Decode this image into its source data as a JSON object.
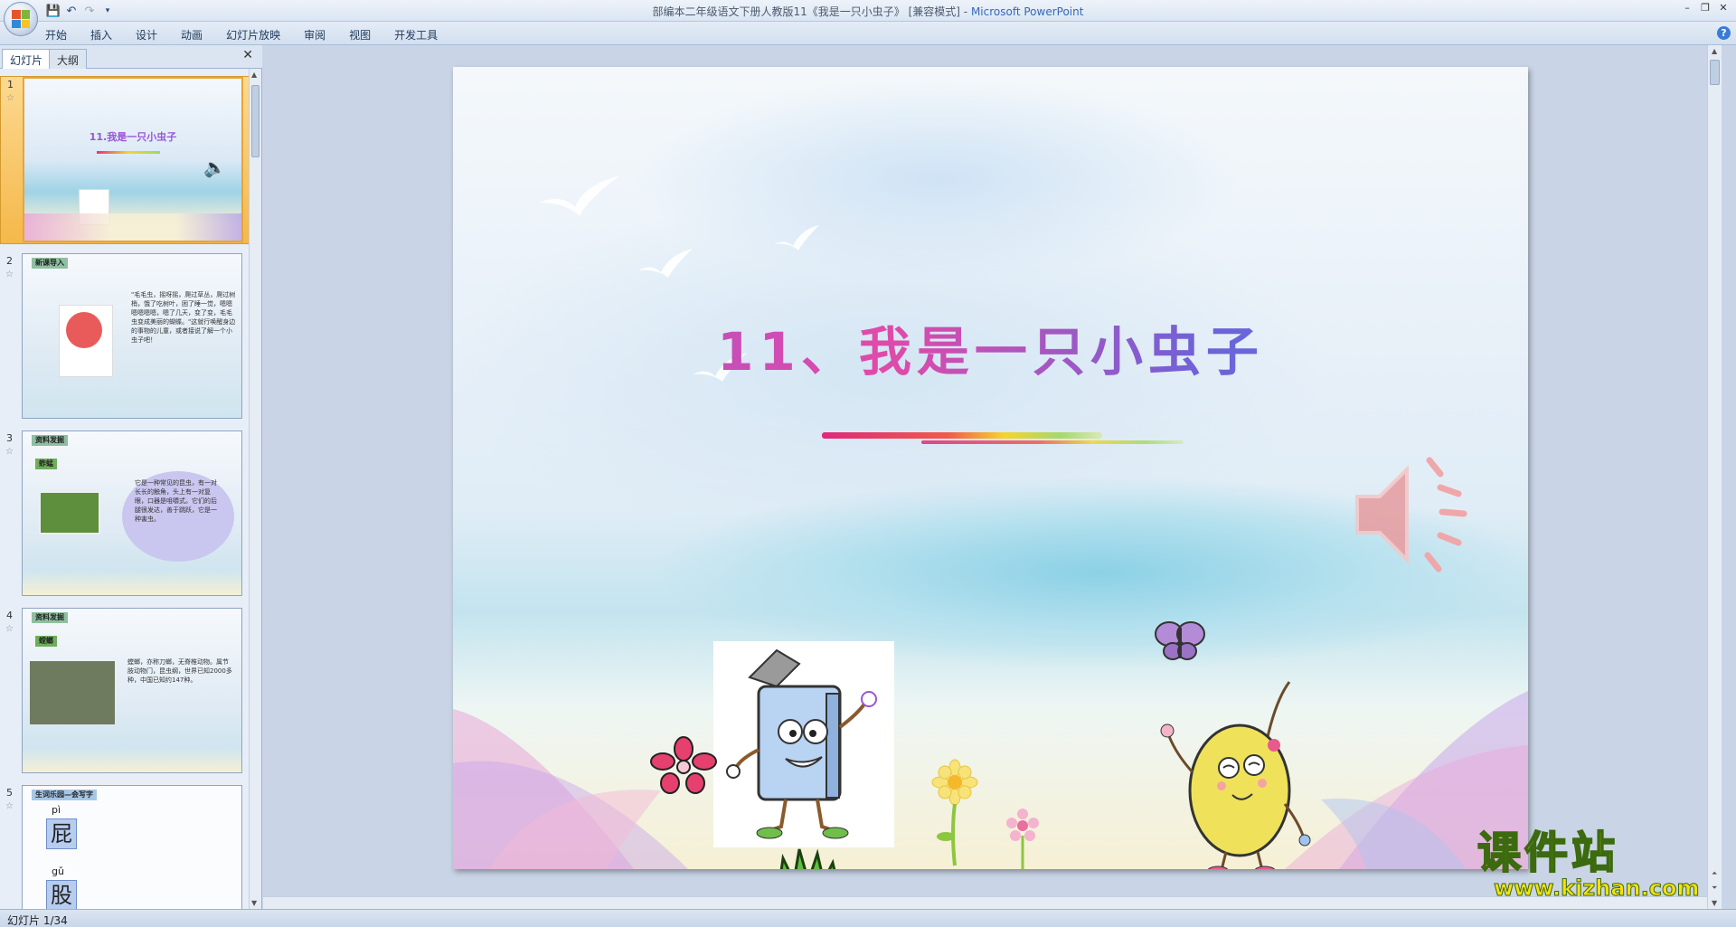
{
  "window": {
    "title": "部编本二年级语文下册人教版11《我是一只小虫子》 [兼容模式] - ",
    "app_name": "Microsoft PowerPoint",
    "minimize": "–",
    "restore": "❐",
    "close": "✕"
  },
  "quick_access": {
    "save": "💾",
    "undo": "↶",
    "redo": "↷",
    "customize": "▾"
  },
  "ribbon": {
    "tabs": [
      "开始",
      "插入",
      "设计",
      "动画",
      "幻灯片放映",
      "审阅",
      "视图",
      "开发工具"
    ],
    "help": "?"
  },
  "left_pane": {
    "tabs": {
      "slides": "幻灯片",
      "outline": "大纲"
    },
    "close": "✕",
    "thumbnails": [
      {
        "num": "1",
        "title": "11.我是一只小虫子"
      },
      {
        "num": "2",
        "header": "新课导入",
        "text": "\"毛毛虫，摇呀摇，爬过草丛，爬过树梢，饿了吃树叶，困了睡一觉，嗯嗯嗯嗯嗯嗯，嗯了几天，变了变，毛毛虫变成美丽的蝴蝶。\"这就行唤醒身边的事物的儿童，或者接说了解一个小虫子吧！"
      },
      {
        "num": "3",
        "header": "资料发掘",
        "tag": "蚱蜢",
        "text": "它是一种常见的昆虫，有一对长长的触角，头上有一对复眼，口器是咀嚼式。它们的后腿很发达，善于跳跃，它是一种害虫。"
      },
      {
        "num": "4",
        "header": "资料发掘",
        "tag": "螳螂",
        "text": "螳螂，亦称刀螂，无脊椎动物。属节肢动物门，昆虫纲，世界已知2000多种，中国已知约147种。"
      },
      {
        "num": "5",
        "header": "生词乐园—会写字",
        "char1": "屁",
        "py1": "pì",
        "char2": "股",
        "py2": "gǔ"
      }
    ]
  },
  "slide": {
    "title": "11、我是一只小虫子"
  },
  "watermark": {
    "cn": "课件站",
    "url": "www.kjzhan.com"
  },
  "status_bar": {
    "slide_info": "幻灯片 1/34"
  },
  "colors": {
    "accent": "#3569b5",
    "selection": "#f5b84a",
    "title_gradient_start": "#9a55d6",
    "title_gradient_end": "#4a86e0"
  }
}
